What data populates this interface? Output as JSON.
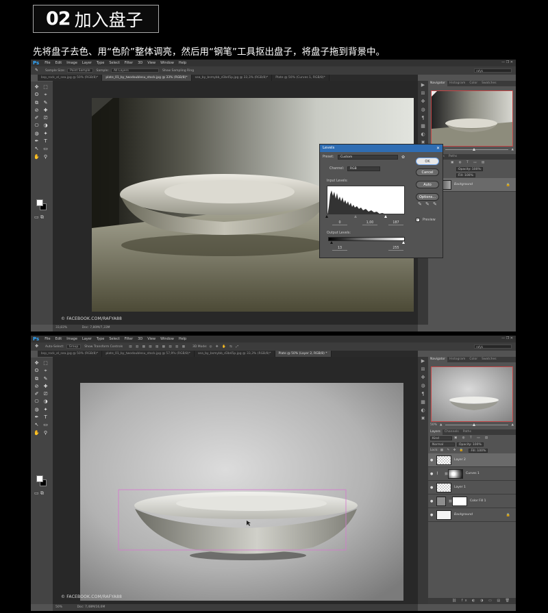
{
  "header": {
    "number": "02",
    "title": "加入盘子"
  },
  "subtitle": "先将盘子去色、用“色阶”整体调亮，然后用“钢笔”工具抠出盘子，将盘子拖到背景中。",
  "ps_logo": "Ps",
  "menu": [
    "File",
    "Edit",
    "Image",
    "Layer",
    "Type",
    "Select",
    "Filter",
    "3D",
    "View",
    "Window",
    "Help"
  ],
  "window_controls": "—  ❐  ✕",
  "credit": "© FACEBOOK.COM/RAFYA88",
  "tools": [
    "✥",
    "⬚",
    "ʘ",
    "⌖",
    "⧉",
    "✎",
    "⊘",
    "✚",
    "✐",
    "⎚",
    "⎔",
    "◑",
    "◍",
    "✦",
    "✒",
    "T",
    "↖",
    "▭",
    "✋",
    "⚲"
  ],
  "screen1": {
    "options": {
      "sample_size_label": "Sample Size:",
      "sample_size": "Point Sample",
      "sample_label": "Sample:",
      "sample": "All Layers",
      "show_ring": "Show Sampling Ring",
      "search": "rafyk"
    },
    "tabs": [
      "bsp_rock_el_sea.jpg @ 50% (RGB/8)*",
      "plate_01_by_twodoublesu_stock.jpg @ 33% (RGB/8)*",
      "sea_by_bsmybb_d3b45p.jpg @ 33,3% (RGB/8)*",
      "Plate @ 50% (Curves 1, RGB/8)*"
    ],
    "status_zoom": "33,83%",
    "status_doc": "Doc: 7,80M/7,33M",
    "panel_tabs": [
      "Navigator",
      "Histogram",
      "Color",
      "Swatches"
    ],
    "zoom_pct": "33%",
    "mid_tabs": [
      "Channels",
      "Paths"
    ],
    "opacity": "Opacity: 100%",
    "fill": "Fill: 100%",
    "layers": [
      {
        "name": "Background"
      }
    ]
  },
  "levels": {
    "title": "Levels",
    "preset_label": "Preset:",
    "preset": "Custom",
    "channel_label": "Channel:",
    "channel": "RGB",
    "input_label": "Input Levels:",
    "input_black": "0",
    "input_mid": "1,00",
    "input_white": "187",
    "output_label": "Output Levels:",
    "output_black": "13",
    "output_white": "255",
    "ok": "OK",
    "cancel": "Cancel",
    "auto": "Auto",
    "options": "Options...",
    "preview": "Preview"
  },
  "screen2": {
    "options": {
      "auto_select": "Auto-Select:",
      "auto_select_target": "Group",
      "show_transform": "Show Transform Controls",
      "mode_3d": "3D Mode:",
      "search": "rafyk"
    },
    "tabs": [
      "bsp_rock_el_sea.jpg @ 50% (RGB/8)*",
      "plate_01_by_twodoublesu_stock.jpg @ 57,9% (RGB/8)*",
      "sea_by_bsmybb_d3b45p.jpg @ 33,3% (RGB/8)*",
      "Plate @ 50% (Layer 2, RGB/8) *"
    ],
    "status_zoom": "50%",
    "status_doc": "Doc: 7,48M/16,6M",
    "panel_tabs": [
      "Navigator",
      "Histogram",
      "Color",
      "Swatches"
    ],
    "zoom_pct": "50%",
    "layer_tabs": [
      "Layers",
      "Channels",
      "Paths"
    ],
    "kind": "Kind",
    "blend": "Normal",
    "opacity": "Opacity: 100%",
    "lock_label": "Lock:",
    "fill": "Fill: 100%",
    "layers": [
      {
        "name": "Layer 2"
      },
      {
        "name": "Curves 1"
      },
      {
        "name": "Layer 1"
      },
      {
        "name": "Color Fill 1"
      },
      {
        "name": "Background"
      }
    ],
    "footer_icons": "⛓ fx ◐ ◑ ▭ ▤ 🗑"
  },
  "colors": {
    "accent": "#31a8ff",
    "dialog_title": "#2f6db3",
    "nav_border": "#c54545",
    "selection": "#d774d0"
  }
}
